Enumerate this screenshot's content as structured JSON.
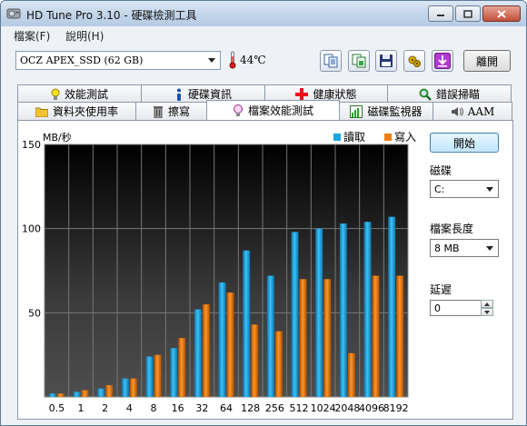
{
  "window": {
    "title": "HD Tune Pro 3.10 - 硬碟檢測工具"
  },
  "menu": [
    {
      "label": "檔案(F)"
    },
    {
      "label": "說明(H)"
    }
  ],
  "toolbar": {
    "drive": "OCZ APEX_SSD (62 GB)",
    "temperature": "44℃",
    "buttons": [
      "copy-text-icon",
      "copy-screenshot-icon",
      "save-icon",
      "options-icon",
      "download-icon"
    ],
    "exit_label": "離開"
  },
  "tabs_top": [
    {
      "label": "效能測試",
      "icon": "info-bulb-icon"
    },
    {
      "label": "硬碟資訊",
      "icon": "info-icon"
    },
    {
      "label": "健康狀態",
      "icon": "health-cross-icon"
    },
    {
      "label": "錯誤掃瞄",
      "icon": "magnifier-icon"
    }
  ],
  "tabs_bottom": [
    {
      "label": "資料夾使用率",
      "icon": "folder-icon"
    },
    {
      "label": "擦寫",
      "icon": "trash-icon"
    },
    {
      "label": "檔案效能測試",
      "icon": "file-benchmark-icon",
      "active": true
    },
    {
      "label": "磁碟監視器",
      "icon": "monitor-chart-icon"
    },
    {
      "label": "AAM",
      "icon": "speaker-icon"
    }
  ],
  "side": {
    "start_label": "開始",
    "drive_label": "磁碟",
    "drive_value": "C:",
    "length_label": "檔案長度",
    "length_value": "8 MB",
    "delay_label": "延遲",
    "delay_value": "0"
  },
  "chart_data": {
    "type": "bar",
    "ylabel": "MB/秒",
    "ylim": [
      0,
      150
    ],
    "yticks": [
      50,
      100,
      150
    ],
    "categories": [
      "0.5",
      "1",
      "2",
      "4",
      "8",
      "16",
      "32",
      "64",
      "128",
      "256",
      "512",
      "1024",
      "2048",
      "4096",
      "8192"
    ],
    "series": [
      {
        "name": "讀取",
        "color": "#1aa6e0",
        "values": [
          2,
          3,
          5,
          11,
          24,
          29,
          52,
          68,
          87,
          72,
          98,
          100,
          103,
          104,
          107
        ]
      },
      {
        "name": "寫入",
        "color": "#f07d10",
        "values": [
          2,
          4,
          7,
          11,
          25,
          35,
          55,
          62,
          43,
          39,
          70,
          70,
          26,
          72,
          72
        ]
      }
    ],
    "grid": true,
    "legend": "top-right"
  }
}
